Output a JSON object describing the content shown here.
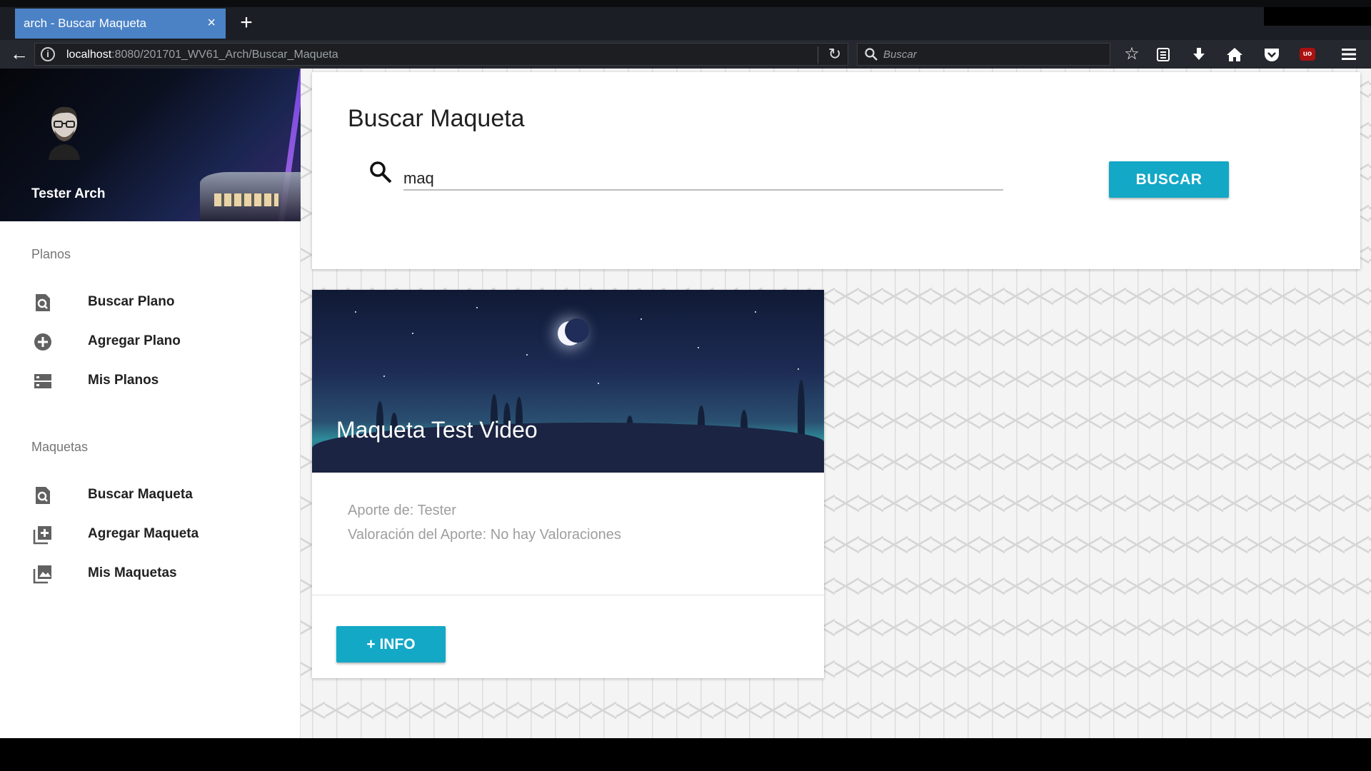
{
  "browser": {
    "tab_title": "arch - Buscar Maqueta",
    "tab_close": "×",
    "new_tab": "+",
    "url_host": "localhost",
    "url_path": ":8080/201701_WV61_Arch/Buscar_Maqueta",
    "search_placeholder": "Buscar",
    "icons": [
      "back-arrow-icon",
      "info-icon",
      "reload-icon",
      "search-icon",
      "bookmark-star-icon",
      "reading-list-icon",
      "download-icon",
      "home-icon",
      "pocket-icon",
      "ublock-icon",
      "hamburger-menu-icon"
    ],
    "ublock_label": "uo"
  },
  "sidebar": {
    "user_name": "Tester Arch",
    "sections": [
      {
        "label": "Planos",
        "items": [
          {
            "label": "Buscar Plano",
            "icon": "search-document-icon"
          },
          {
            "label": "Agregar Plano",
            "icon": "add-circle-icon"
          },
          {
            "label": "Mis Planos",
            "icon": "storage-icon"
          }
        ]
      },
      {
        "label": "Maquetas",
        "items": [
          {
            "label": "Buscar Maqueta",
            "icon": "search-document-icon"
          },
          {
            "label": "Agregar Maqueta",
            "icon": "add-library-icon"
          },
          {
            "label": "Mis Maquetas",
            "icon": "photo-library-icon"
          }
        ]
      }
    ]
  },
  "search": {
    "title": "Buscar Maqueta",
    "query": "maq",
    "button_label": "BUSCAR"
  },
  "results": [
    {
      "title": "Maqueta Test Video",
      "author_line": "Aporte de: Tester",
      "rating_line": "Valoración del Aporte: No hay Valoraciones",
      "button_label": "+ INFO"
    }
  ],
  "colors": {
    "accent": "#13a8c6",
    "tab_active": "#4b82c6",
    "chrome_dark": "#25282e"
  }
}
